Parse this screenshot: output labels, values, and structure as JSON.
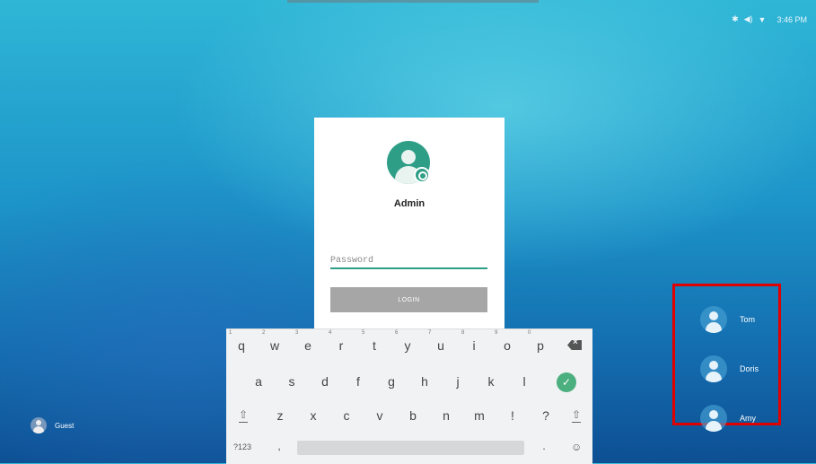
{
  "status_bar": {
    "time": "3:46 PM",
    "icons": [
      "bluetooth-icon",
      "volume-icon",
      "wifi-icon"
    ]
  },
  "login": {
    "user_name": "Admin",
    "password_placeholder": "Password",
    "password_value": "",
    "login_label": "LOGIN",
    "accent_color": "#2e9e86"
  },
  "keyboard": {
    "row1": [
      {
        "k": "q",
        "h": "1"
      },
      {
        "k": "w",
        "h": "2"
      },
      {
        "k": "e",
        "h": "3"
      },
      {
        "k": "r",
        "h": "4"
      },
      {
        "k": "t",
        "h": "5"
      },
      {
        "k": "y",
        "h": "6"
      },
      {
        "k": "u",
        "h": "7"
      },
      {
        "k": "i",
        "h": "8"
      },
      {
        "k": "o",
        "h": "9"
      },
      {
        "k": "p",
        "h": "0"
      }
    ],
    "row2": [
      "a",
      "s",
      "d",
      "f",
      "g",
      "h",
      "j",
      "k",
      "l"
    ],
    "row3": [
      "z",
      "x",
      "c",
      "v",
      "b",
      "n",
      "m",
      "!",
      "?"
    ],
    "row4": {
      "symbols": "?123",
      "comma": ",",
      "period": "."
    }
  },
  "users": [
    "Tom",
    "Doris",
    "Amy"
  ],
  "guest": "Guest",
  "highlight_color": "#e00000"
}
